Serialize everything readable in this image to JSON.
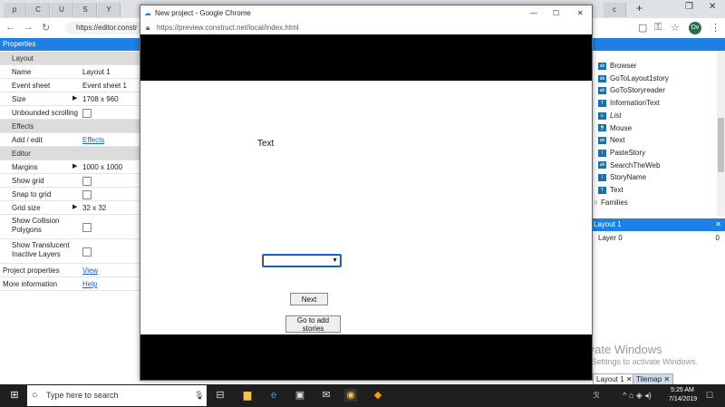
{
  "background_browser": {
    "tabs": [
      "p",
      "C",
      "U",
      "S",
      "Y"
    ],
    "tab_right": "c",
    "url": "https://editor.constr",
    "profile": "Dv"
  },
  "properties": {
    "title": "Properties",
    "rows": [
      {
        "key": "Layout",
        "type": "section"
      },
      {
        "key": "Name",
        "value": "Layout 1"
      },
      {
        "key": "Event sheet",
        "value": "Event sheet 1"
      },
      {
        "key": "Size",
        "value": "1708 x 960",
        "expand": true
      },
      {
        "key": "Unbounded scrolling",
        "checkbox": true
      },
      {
        "key": "Effects",
        "type": "section"
      },
      {
        "key": "Add / edit",
        "link": "Effects"
      },
      {
        "key": "Editor",
        "type": "section"
      },
      {
        "key": "Margins",
        "value": "1000 x 1000",
        "expand": true
      },
      {
        "key": "Show grid",
        "checkbox": true
      },
      {
        "key": "Snap to grid",
        "checkbox": true
      },
      {
        "key": "Grid size",
        "value": "32 x 32",
        "expand": true
      },
      {
        "key": "Show Collision Polygons",
        "checkbox": true,
        "tall": true
      },
      {
        "key": "Show Translucent Inactive Layers",
        "checkbox": true,
        "tall": true
      },
      {
        "key": "Project properties",
        "link": "View",
        "top": true
      },
      {
        "key": "More information",
        "link": "Help",
        "top": true
      }
    ]
  },
  "objects": {
    "items": [
      "Browser",
      "GoToLayout1story",
      "GoToStoryreader",
      "InformationText",
      "List",
      "Mouse",
      "Next",
      "PasteStory",
      "SearchTheWeb",
      "StoryName",
      "Text",
      "Families"
    ]
  },
  "layers": {
    "title": "Layout 1",
    "rows": [
      {
        "name": "Layer 0",
        "value": "0"
      }
    ]
  },
  "watermark": {
    "line1": "Activate Windows",
    "line2": "Go to Settings to activate Windows."
  },
  "bottom_tabs": [
    "Layout 1",
    "Tilemap"
  ],
  "popup": {
    "title": "New project - Google Chrome",
    "url": "https://preview.construct.net/local/index.html",
    "text_object": "Text",
    "next_label": "Next",
    "add_stories_label": "Go to add stories"
  },
  "taskbar": {
    "search_placeholder": "Type here to search",
    "time": "5:25 AM",
    "date": "7/14/2019"
  },
  "colors": {
    "accent": "#1e80e3",
    "taskbar": "#1f1f1f"
  }
}
